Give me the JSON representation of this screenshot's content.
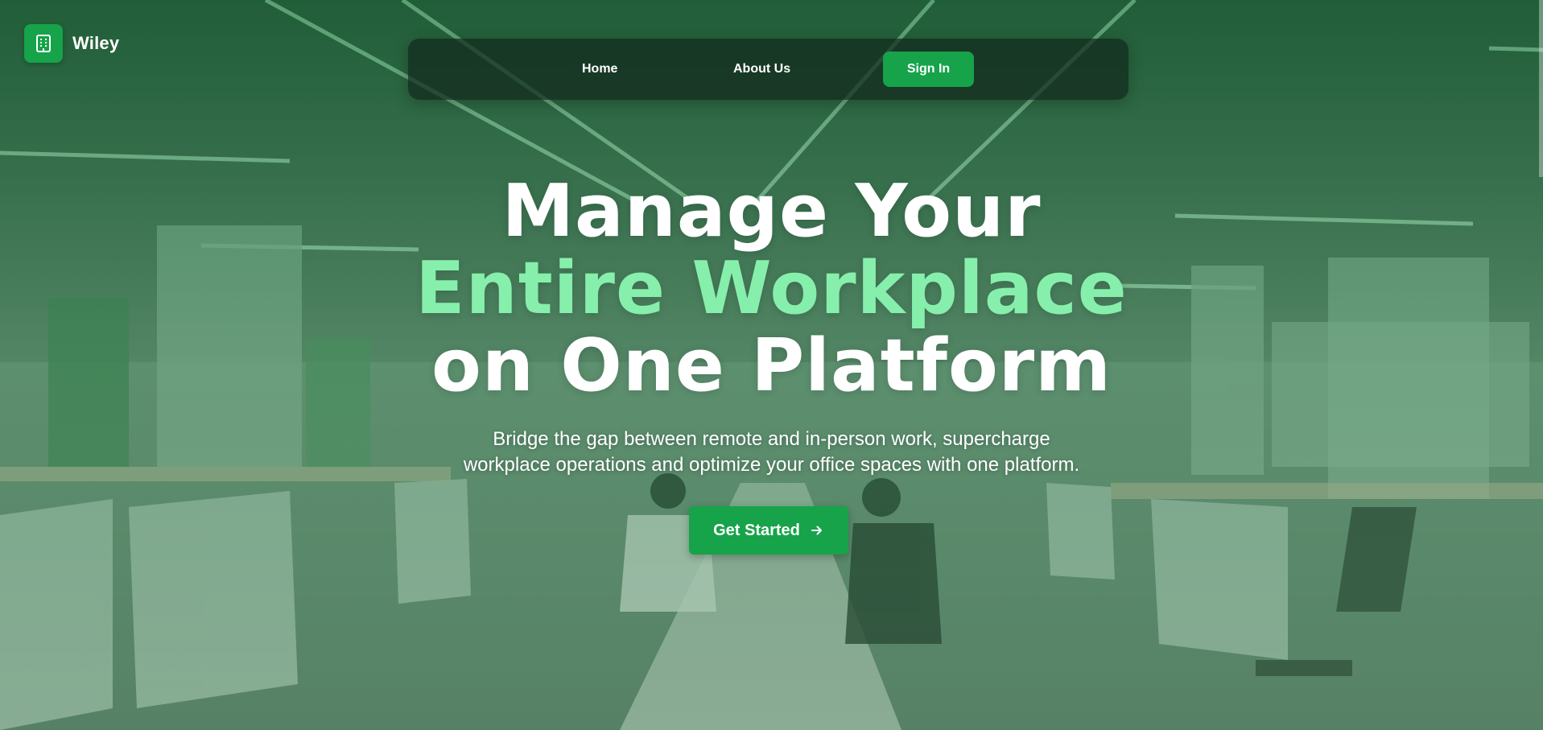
{
  "brand": {
    "name": "Wiley",
    "logo_icon": "building-icon",
    "color": "#16a34a"
  },
  "nav": {
    "home_label": "Home",
    "about_label": "About Us",
    "signin_label": "Sign In"
  },
  "hero": {
    "line1": "Manage Your",
    "line2": "Entire Workplace",
    "line3": "on One Platform",
    "accent_color": "#86efac",
    "subtitle_line1": "Bridge the gap between remote and in-person work, supercharge",
    "subtitle_line2": "workplace operations and optimize your office spaces with one platform.",
    "cta_label": "Get Started",
    "cta_icon": "arrow-right-icon"
  }
}
